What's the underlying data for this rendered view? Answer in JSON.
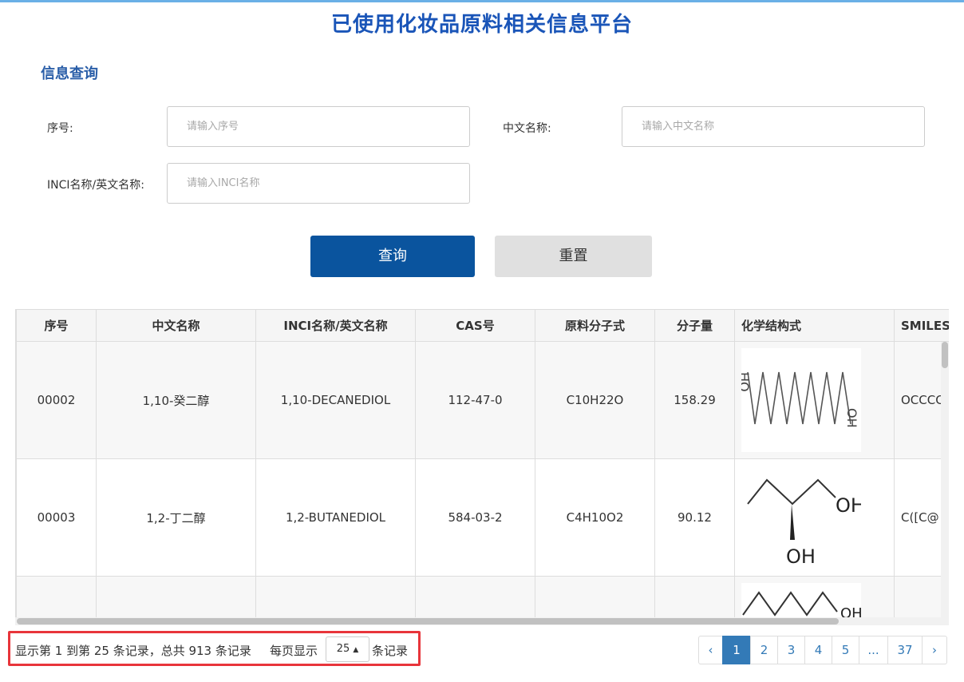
{
  "header": {
    "title": "已使用化妆品原料相关信息平台"
  },
  "search": {
    "section_title": "信息查询",
    "serial_label": "序号:",
    "serial_placeholder": "请输入序号",
    "cn_name_label": "中文名称:",
    "cn_name_placeholder": "请输入中文名称",
    "inci_label": "INCI名称/英文名称:",
    "inci_placeholder": "请输入INCI名称",
    "query_button": "查询",
    "reset_button": "重置"
  },
  "table": {
    "columns": [
      "序号",
      "中文名称",
      "INCI名称/英文名称",
      "CAS号",
      "原料分子式",
      "分子量",
      "化学结构式",
      "SMILES"
    ],
    "rows": [
      {
        "serial": "00002",
        "cn_name": "1,10-癸二醇",
        "inci": "1,10-DECANEDIOL",
        "cas": "112-47-0",
        "formula": "C10H22O",
        "mw": "158.29",
        "structure_icon": "decanediol-structure-image",
        "smiles": "OCCCC"
      },
      {
        "serial": "00003",
        "cn_name": "1,2-丁二醇",
        "inci": "1,2-BUTANEDIOL",
        "cas": "584-03-2",
        "formula": "C4H10O2",
        "mw": "90.12",
        "structure_icon": "butanediol-structure-image",
        "smiles": "C([C@"
      },
      {
        "serial": "",
        "cn_name": "",
        "inci": "",
        "cas": "",
        "formula": "",
        "mw": "",
        "structure_icon": "hexanediol-structure-image",
        "smiles": ""
      }
    ]
  },
  "footer": {
    "info_prefix": "显示第 1 到第 25 条记录，总共 913 条记录",
    "per_page_label": "每页显示",
    "per_page_value": "25",
    "per_page_suffix": "条记录",
    "pages": [
      "‹",
      "1",
      "2",
      "3",
      "4",
      "5",
      "...",
      "37",
      "›"
    ],
    "active_page": "1"
  },
  "colors": {
    "title": "#1a55b8",
    "primary_button": "#0a549e",
    "active_page": "#337ab7",
    "highlight_border": "#e8353b"
  }
}
